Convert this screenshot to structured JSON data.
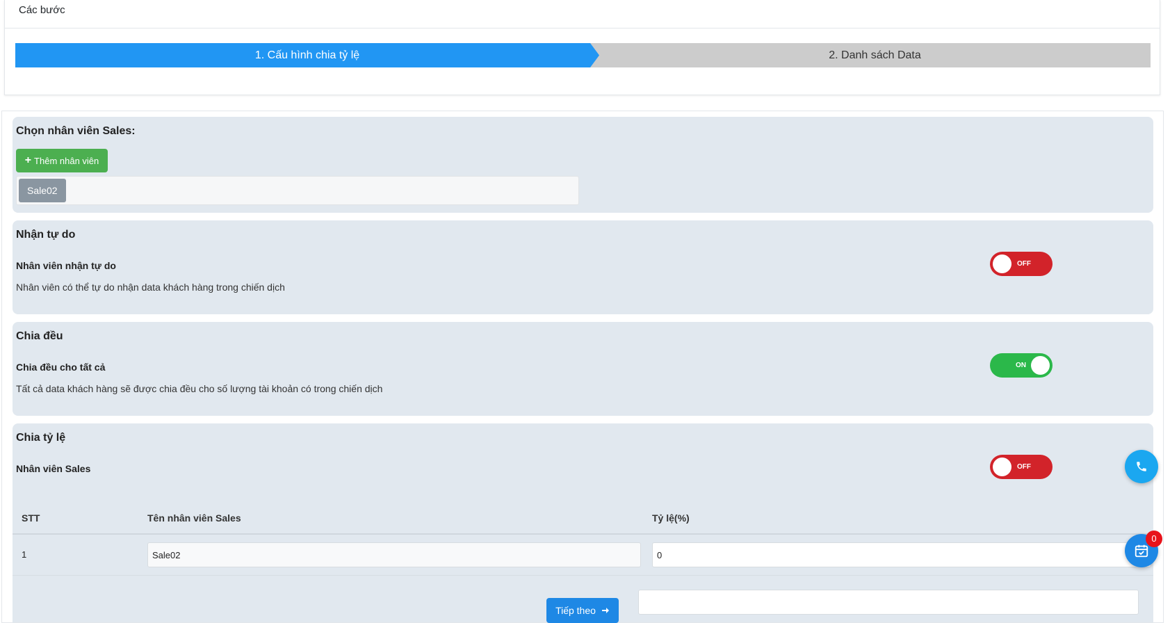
{
  "steps": {
    "header": "Các bước",
    "items": [
      {
        "label": "1. Cấu hình chia tỷ lệ",
        "active": true
      },
      {
        "label": "2. Danh sách Data",
        "active": false
      }
    ]
  },
  "sales_select": {
    "title": "Chọn nhân viên Sales:",
    "add_button": "Thêm nhân viên",
    "tags": [
      "Sale02"
    ]
  },
  "free_receive": {
    "title": "Nhận tự do",
    "label": "Nhân viên nhận tự do",
    "description": "Nhân viên có thể tự do nhận data khách hàng trong chiến dịch",
    "toggle": "OFF"
  },
  "equal_split": {
    "title": "Chia đều",
    "label": "Chia đều cho tất cả",
    "description": "Tất cả data khách hàng sẽ được chia đều cho số lượng tài khoản có trong chiến dịch",
    "toggle": "ON"
  },
  "ratio_split": {
    "title": "Chia tỷ lệ",
    "label": "Nhân viên Sales",
    "toggle": "OFF",
    "columns": [
      "STT",
      "Tên nhân viên Sales",
      "Tỷ lệ(%)"
    ],
    "rows": [
      {
        "stt": "1",
        "name": "Sale02",
        "ratio": "0"
      }
    ]
  },
  "footer": {
    "next_button": "Tiếp theo"
  },
  "widgets": {
    "calendar_badge": "0"
  },
  "colors": {
    "primary": "#2196f3",
    "success": "#4caf50",
    "toggle_off": "#d2232a",
    "toggle_on": "#2bb84a",
    "panel_bg": "#e1e8ef"
  }
}
